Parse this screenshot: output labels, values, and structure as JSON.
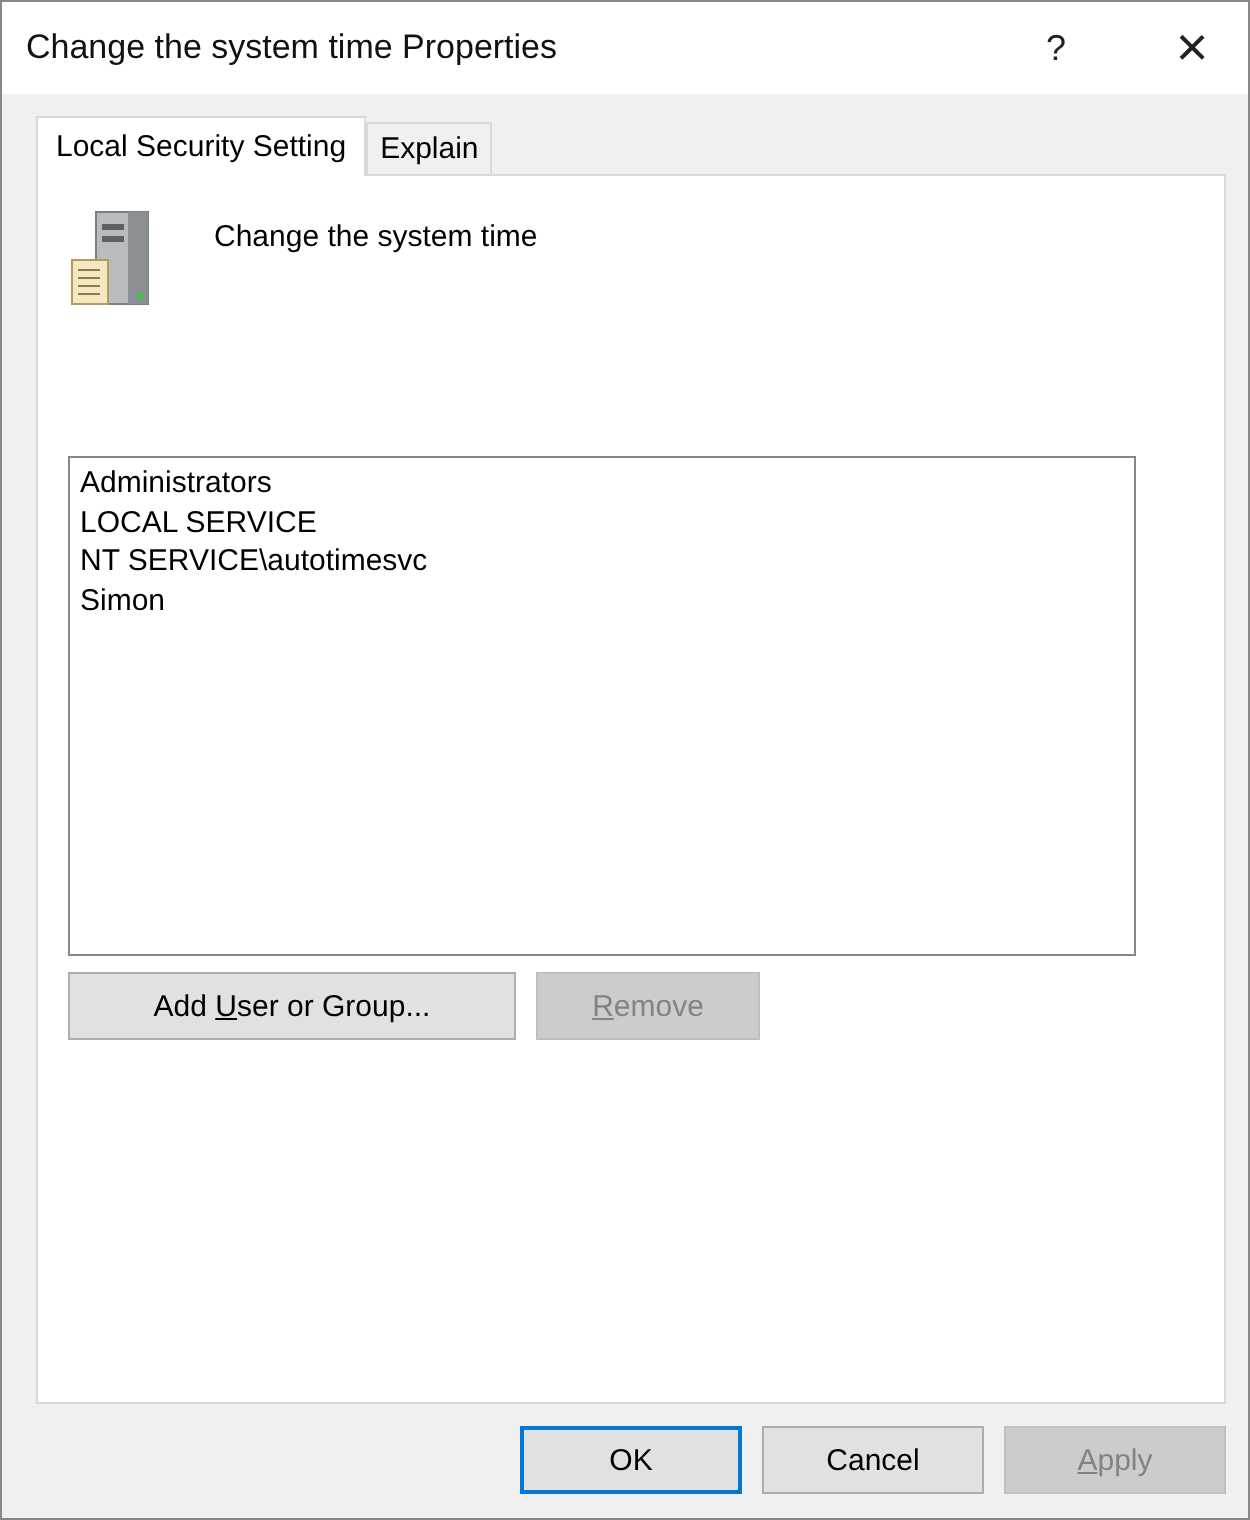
{
  "window": {
    "title": "Change the system time Properties",
    "help": "?",
    "close": "×"
  },
  "tabs": [
    {
      "label": "Local Security Setting",
      "selected": true
    },
    {
      "label": "Explain",
      "selected": false
    }
  ],
  "policy": {
    "name": "Change the system time"
  },
  "accounts": [
    {
      "name": "Administrators"
    },
    {
      "name": "LOCAL SERVICE"
    },
    {
      "name": "NT SERVICE\\autotimesvc"
    },
    {
      "name": "Simon"
    }
  ],
  "list_buttons": [
    {
      "label_before": "Add ",
      "access_key": "U",
      "label_after": "ser or Group...",
      "disabled": false
    },
    {
      "access_key": "R",
      "label_after": "emove",
      "disabled": true
    }
  ],
  "dialog_buttons": [
    {
      "label": "OK",
      "default": true,
      "disabled": false
    },
    {
      "label": "Cancel",
      "default": false,
      "disabled": false
    },
    {
      "access_key": "A",
      "label_after": "pply",
      "default": false,
      "disabled": true
    }
  ]
}
